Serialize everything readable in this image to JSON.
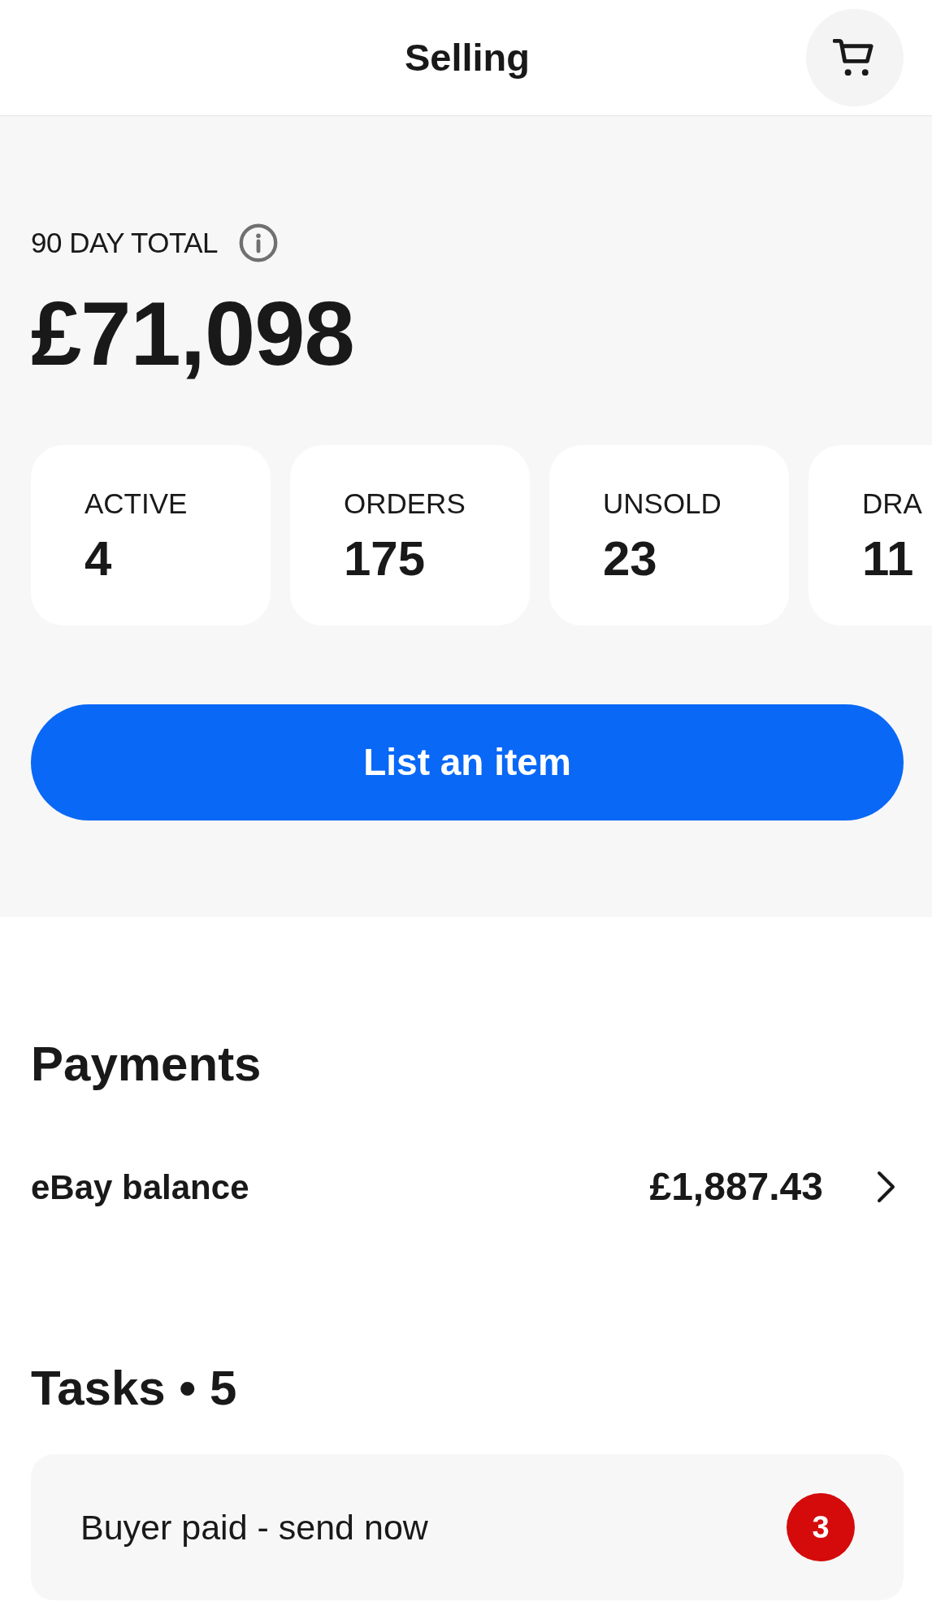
{
  "header": {
    "title": "Selling"
  },
  "summary": {
    "label": "90 DAY TOTAL",
    "amount": "£71,098"
  },
  "stats": [
    {
      "label": "ACTIVE",
      "value": "4"
    },
    {
      "label": "ORDERS",
      "value": "175"
    },
    {
      "label": "UNSOLD",
      "value": "23"
    },
    {
      "label": "DRA",
      "value": "11"
    }
  ],
  "primary_button": {
    "label": "List an item"
  },
  "payments": {
    "heading": "Payments",
    "rows": [
      {
        "label": "eBay balance",
        "amount": "£1,887.43"
      }
    ]
  },
  "tasks": {
    "heading": "Tasks • 5",
    "items": [
      {
        "label": "Buyer paid - send now",
        "count": "3"
      }
    ]
  }
}
